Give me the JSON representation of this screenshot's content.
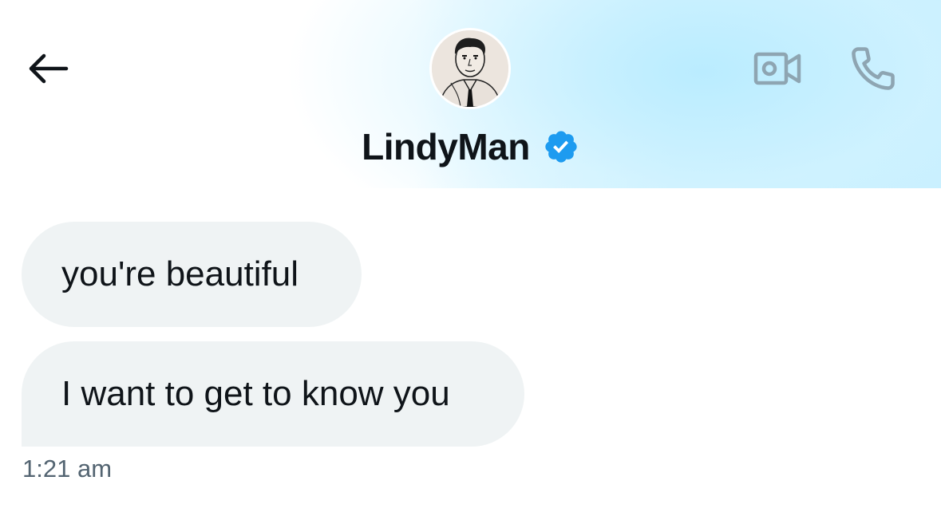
{
  "header": {
    "contact_name": "LindyMan",
    "verified": true,
    "icons": {
      "back": "arrow-left-icon",
      "verified": "verified-badge-icon",
      "video": "video-camera-icon",
      "call": "phone-icon"
    },
    "colors": {
      "verified_blue": "#1d9bf0",
      "icon_gray": "#8ea5b2",
      "gradient_blue": "#c6efff"
    }
  },
  "messages": [
    {
      "text": "you're beautiful"
    },
    {
      "text": "I want to get to know you"
    }
  ],
  "timestamp": "1:21 am",
  "colors": {
    "bubble_bg": "#eff3f4",
    "text": "#0f1419",
    "timestamp": "#536471"
  }
}
